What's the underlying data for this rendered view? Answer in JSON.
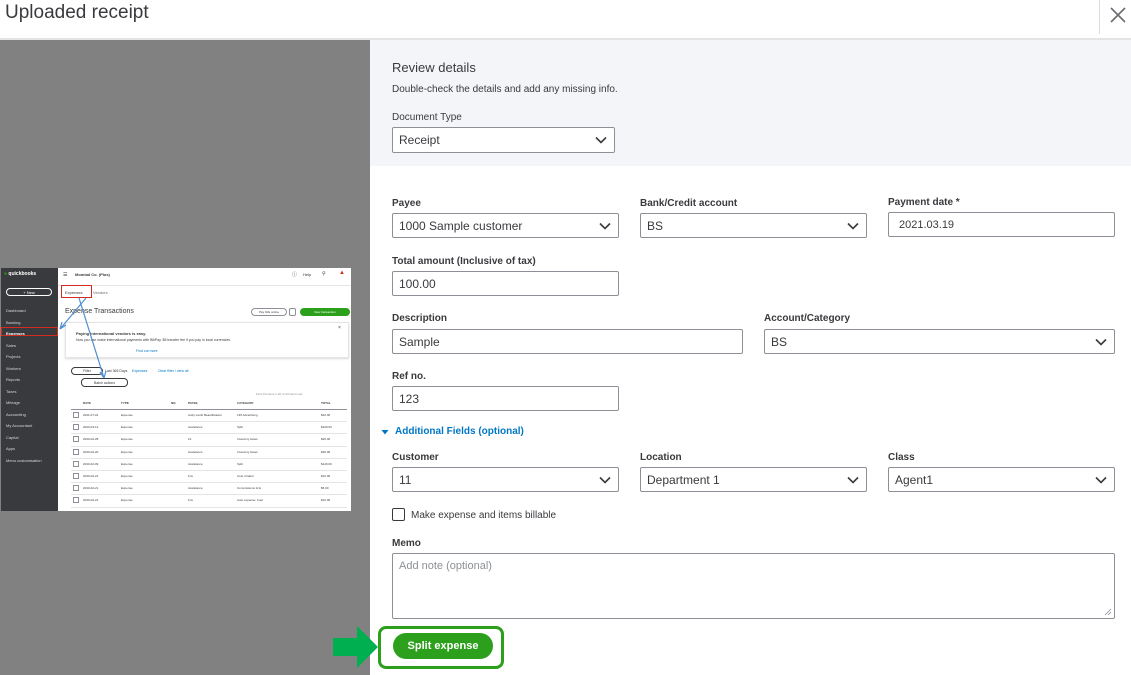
{
  "dialog": {
    "title": "Uploaded receipt",
    "close_icon": "close-icon"
  },
  "review": {
    "title": "Review details",
    "subtitle": "Double-check the details and add any missing info.",
    "doc_type_label": "Document Type",
    "doc_type_value": "Receipt"
  },
  "form": {
    "payee_label": "Payee",
    "payee_value": "1000 Sample customer",
    "bank_label": "Bank/Credit account",
    "bank_value": "BS",
    "payment_date_label": "Payment date *",
    "payment_date_value": "2021.03.19",
    "total_label": "Total amount (Inclusive of tax)",
    "total_value": "100.00",
    "description_label": "Description",
    "description_value": "Sample",
    "account_label": "Account/Category",
    "account_value": "BS",
    "ref_label": "Ref no.",
    "ref_value": "123",
    "additional_fields_label": "Additional Fields (optional)",
    "customer_label": "Customer",
    "customer_value": "11",
    "location_label": "Location",
    "location_value": "Department 1",
    "class_label": "Class",
    "class_value": "Agent1",
    "billable_label": "Make expense and items billable",
    "billable_checked": false,
    "memo_label": "Memo",
    "memo_placeholder": "Add note (optional)",
    "split_button": "Split expense"
  },
  "colors": {
    "accent_green": "#2ca01c",
    "link_blue": "#0077c5",
    "left_pane_gray": "#818181"
  },
  "thumbnail": {
    "company": "Momiad Co. (Plus)",
    "help": "Help",
    "new_button": "+ New",
    "tabs": [
      "Expenses",
      "Vendors"
    ],
    "heading": "Expense Transactions",
    "pay_bills": "Pay bills online",
    "new_transaction": "New transaction",
    "banner_title": "Paying international vendors is easy.",
    "banner_text": "Now you can make international payments with BillPay. $5 transfer fee if you pay in local currencies.",
    "banner_link": "Find out more",
    "filter": "Filter",
    "last365": "Last 365 Days",
    "expenses_chip": "Expenses",
    "clear_filter": "Clear filter / view all",
    "batch_actions": "Batch actions",
    "pagination": "First  Previous  1-20 of 23  Next  Last",
    "sidebar": [
      "Dashboard",
      "Banking",
      "Expenses",
      "Sales",
      "Projects",
      "Workers",
      "Reports",
      "Taxes",
      "Mileage",
      "Accounting",
      "My Accountant",
      "Capital",
      "Apps",
      "Menu customisation"
    ],
    "columns": [
      "DATE",
      "TYPE",
      "NO.",
      "PAYEE",
      "CATEGORY",
      "TOTAL"
    ],
    "rows": [
      [
        "2021-07-01",
        "Expense",
        "",
        "Andy Lamb Beautification",
        "135 Advertising",
        "$10.00"
      ],
      [
        "2020-03-12",
        "Expense",
        "",
        "Assistance",
        "Split",
        "$100.00"
      ],
      [
        "2020-02-28",
        "Expense",
        "",
        "F1",
        "Inventory Asset",
        "$20.00"
      ],
      [
        "2020-02-20",
        "Expense",
        "",
        "Assistance",
        "Inventory Asset",
        "$30.00"
      ],
      [
        "2020-02-09",
        "Expense",
        "",
        "Assistance",
        "Split",
        "$120.00"
      ],
      [
        "2020-02-21",
        "Expense",
        "",
        "Fux",
        "Cost of labor",
        "$10.00"
      ],
      [
        "2020-02-21",
        "Expense",
        "",
        "Assistance",
        "Commissions & fe",
        "$5.00"
      ],
      [
        "2020-02-21",
        "Expense",
        "",
        "Fux",
        "Auto expense: Fuel",
        "$10.00"
      ]
    ]
  }
}
